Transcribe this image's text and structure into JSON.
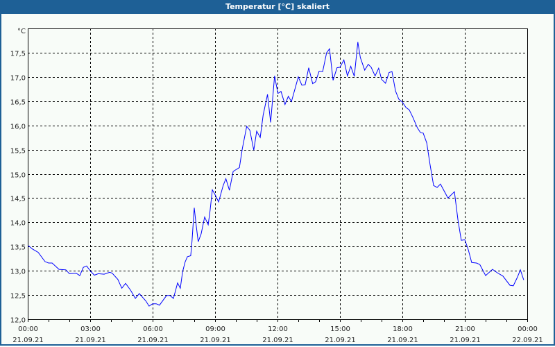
{
  "window": {
    "title": "Temperatur [°C] skaliert"
  },
  "chart_data": {
    "type": "line",
    "title": "Temperatur [°C] skaliert",
    "ylabel": "°C",
    "xlabel": "",
    "ylim": [
      12.0,
      18.0
    ],
    "xlim_hours": [
      0,
      24
    ],
    "grid": true,
    "line_color": "#0000ff",
    "y_ticks": [
      "12,0",
      "12,5",
      "13,0",
      "13,5",
      "14,0",
      "14,5",
      "15,0",
      "15,5",
      "16,0",
      "16,5",
      "17,0",
      "17,5"
    ],
    "x_ticks": [
      {
        "time": "00:00",
        "date": "21.09.21"
      },
      {
        "time": "03:00",
        "date": "21.09.21"
      },
      {
        "time": "06:00",
        "date": "21.09.21"
      },
      {
        "time": "09:00",
        "date": "21.09.21"
      },
      {
        "time": "12:00",
        "date": "21.09.21"
      },
      {
        "time": "15:00",
        "date": "21.09.21"
      },
      {
        "time": "18:00",
        "date": "21.09.21"
      },
      {
        "time": "21:00",
        "date": "21.09.21"
      },
      {
        "time": "00:00",
        "date": "22.09.21"
      }
    ],
    "series": [
      {
        "name": "Temperatur",
        "x": [
          0,
          0.06,
          0.22,
          0.5,
          0.83,
          1.0,
          1.17,
          1.5,
          1.83,
          2.0,
          2.33,
          2.5,
          2.67,
          2.83,
          3.0,
          3.2,
          3.39,
          3.67,
          3.94,
          4.06,
          4.33,
          4.52,
          4.7,
          4.94,
          5.17,
          5.36,
          5.67,
          5.83,
          6.0,
          6.17,
          6.33,
          6.67,
          6.83,
          7.0,
          7.2,
          7.33,
          7.44,
          7.56,
          7.67,
          7.83,
          7.89,
          8.0,
          8.09,
          8.19,
          8.33,
          8.5,
          8.67,
          8.76,
          8.87,
          9.0,
          9.17,
          9.39,
          9.52,
          9.69,
          9.87,
          10.17,
          10.31,
          10.52,
          10.67,
          10.86,
          11.0,
          11.17,
          11.31,
          11.52,
          11.67,
          11.86,
          12.02,
          12.17,
          12.36,
          12.52,
          12.67,
          13.0,
          13.17,
          13.33,
          13.5,
          13.69,
          13.83,
          14.0,
          14.17,
          14.36,
          14.5,
          14.67,
          14.86,
          15.0,
          15.19,
          15.36,
          15.52,
          15.69,
          15.86,
          15.98,
          16.19,
          16.36,
          16.5,
          16.69,
          16.86,
          17.0,
          17.19,
          17.36,
          17.5,
          17.67,
          17.83,
          18.0,
          18.17,
          18.33,
          18.5,
          18.72,
          18.87,
          19.0,
          19.17,
          19.33,
          19.5,
          19.67,
          19.83,
          20.19,
          20.5,
          20.67,
          20.83,
          21.0,
          21.17,
          21.33,
          21.56,
          21.72,
          22.0,
          22.33,
          22.56,
          22.83,
          23.17,
          23.33,
          23.52,
          23.67,
          23.83
        ],
        "y": [
          13.51,
          13.51,
          13.45,
          13.38,
          13.19,
          13.16,
          13.16,
          13.03,
          13.02,
          12.94,
          12.95,
          12.9,
          13.07,
          13.1,
          13.0,
          12.91,
          12.94,
          12.93,
          12.97,
          12.95,
          12.82,
          12.64,
          12.74,
          12.6,
          12.43,
          12.53,
          12.38,
          12.27,
          12.32,
          12.32,
          12.29,
          12.49,
          12.49,
          12.43,
          12.75,
          12.64,
          12.98,
          13.18,
          13.29,
          13.31,
          13.6,
          14.3,
          13.95,
          13.6,
          13.76,
          14.11,
          13.95,
          14.24,
          14.67,
          14.57,
          14.42,
          14.76,
          14.9,
          14.66,
          15.05,
          15.13,
          15.52,
          15.98,
          15.9,
          15.49,
          15.88,
          15.75,
          16.21,
          16.64,
          16.06,
          17.02,
          16.66,
          16.7,
          16.43,
          16.6,
          16.49,
          17.0,
          16.83,
          16.84,
          17.19,
          16.86,
          16.9,
          17.12,
          17.11,
          17.5,
          17.58,
          16.93,
          17.19,
          17.2,
          17.35,
          17.02,
          17.22,
          17.01,
          17.72,
          17.4,
          17.14,
          17.26,
          17.2,
          17.02,
          17.18,
          16.95,
          16.87,
          17.09,
          17.11,
          16.71,
          16.54,
          16.48,
          16.37,
          16.32,
          16.17,
          15.95,
          15.85,
          15.84,
          15.64,
          15.19,
          14.76,
          14.72,
          14.79,
          14.5,
          14.63,
          14.05,
          13.63,
          13.64,
          13.43,
          13.17,
          13.16,
          13.13,
          12.9,
          13.03,
          12.96,
          12.89,
          12.7,
          12.69,
          12.86,
          13.02,
          12.81
        ]
      }
    ]
  }
}
